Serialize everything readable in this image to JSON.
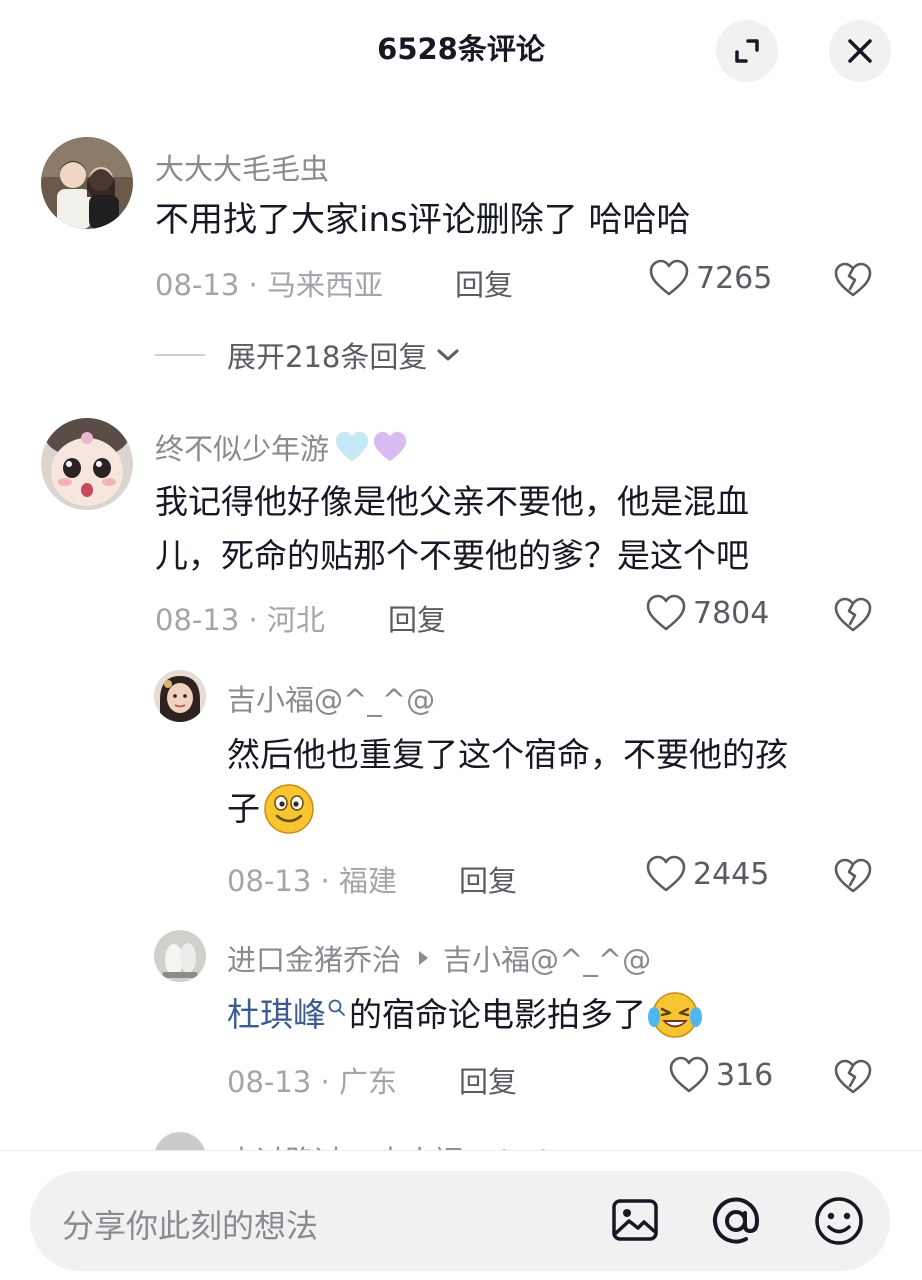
{
  "header": {
    "title": "6528条评论"
  },
  "comments": [
    {
      "username": "大大大毛毛虫",
      "text": "不用找了大家ins评论删除了 哈哈哈",
      "date": "08-13",
      "location": "马来西亚",
      "reply_label": "回复",
      "likes": "7265"
    },
    {
      "username": "终不似少年游",
      "text_line1": "我记得他好像是他父亲不要他，他是混血",
      "text_line2": "儿，死命的贴那个不要他的爹？是这个吧",
      "date": "08-13",
      "location": "河北",
      "reply_label": "回复",
      "likes": "7804"
    }
  ],
  "expand_replies": {
    "label": "展开218条回复"
  },
  "replies": [
    {
      "username": "吉小福@^_^@",
      "text_line1": "然后他也重复了这个宿命，不要他的孩",
      "text_line2": "子",
      "date": "08-13",
      "location": "福建",
      "reply_label": "回复",
      "likes": "2445"
    },
    {
      "username": "进口金猪乔治",
      "reply_to": "吉小福@^_^@",
      "mention": "杜琪峰",
      "text": "的宿命论电影拍多了",
      "date": "08-13",
      "location": "广东",
      "reply_label": "回复",
      "likes": "316"
    }
  ],
  "partial_row": {
    "text": "走过路过 ▸ 吉小福@^_^@"
  },
  "input": {
    "placeholder": "分享你此刻的想法"
  },
  "colors": {
    "text": "#161823",
    "secondary": "#8a8b91",
    "mention": "#3b5c8f",
    "input_bg": "#f1f1f2"
  },
  "icons": [
    "expand-icon",
    "close-icon",
    "heart-icon",
    "dislike-icon",
    "chevron-down-icon",
    "search-icon",
    "image-icon",
    "at-icon",
    "emoji-icon"
  ]
}
